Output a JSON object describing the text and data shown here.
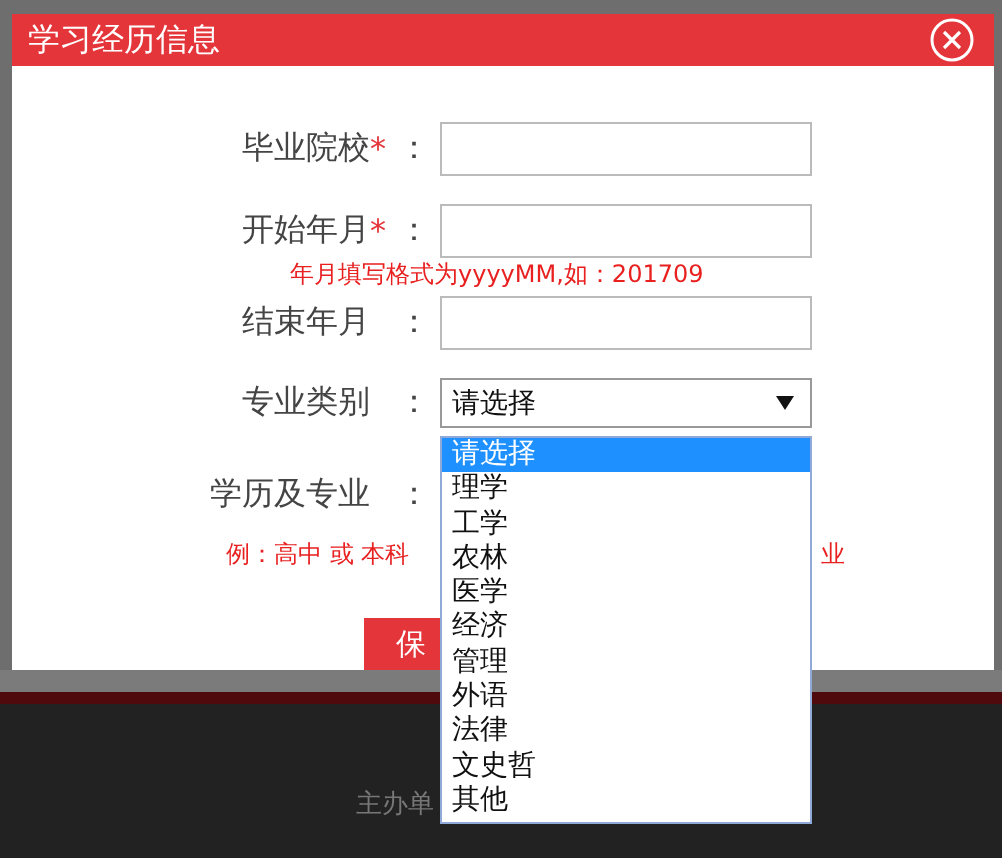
{
  "dialog": {
    "title": "学习经历信息",
    "fields": [
      {
        "kind": "input",
        "label": "毕业院校",
        "mark": "*",
        "colon": "："
      },
      {
        "kind": "input",
        "label": "开始年月",
        "mark": "*",
        "colon": "：",
        "hint": "年月填写格式为yyyyMM,如：201709"
      },
      {
        "kind": "input",
        "label": "结束年月",
        "colon": "："
      },
      {
        "kind": "select",
        "label": "专业类别",
        "colon": "：",
        "value": "请选择"
      },
      {
        "kind": "covered",
        "label": "学历及专业",
        "colon": "："
      }
    ],
    "example_hint": [
      "例：高中 或 本科",
      "业"
    ],
    "save_button": "保"
  },
  "dropdown": [
    {
      "label": "请选择",
      "selected": true
    },
    {
      "label": "理学",
      "selected": false
    },
    {
      "label": "工学",
      "selected": false
    },
    {
      "label": "农林",
      "selected": false
    },
    {
      "label": "医学",
      "selected": false
    },
    {
      "label": "经济",
      "selected": false
    },
    {
      "label": "管理",
      "selected": false
    },
    {
      "label": "外语",
      "selected": false
    },
    {
      "label": "法律",
      "selected": false
    },
    {
      "label": "文史哲",
      "selected": false
    },
    {
      "label": "其他",
      "selected": false
    }
  ],
  "footer": {
    "text": "主办单"
  }
}
